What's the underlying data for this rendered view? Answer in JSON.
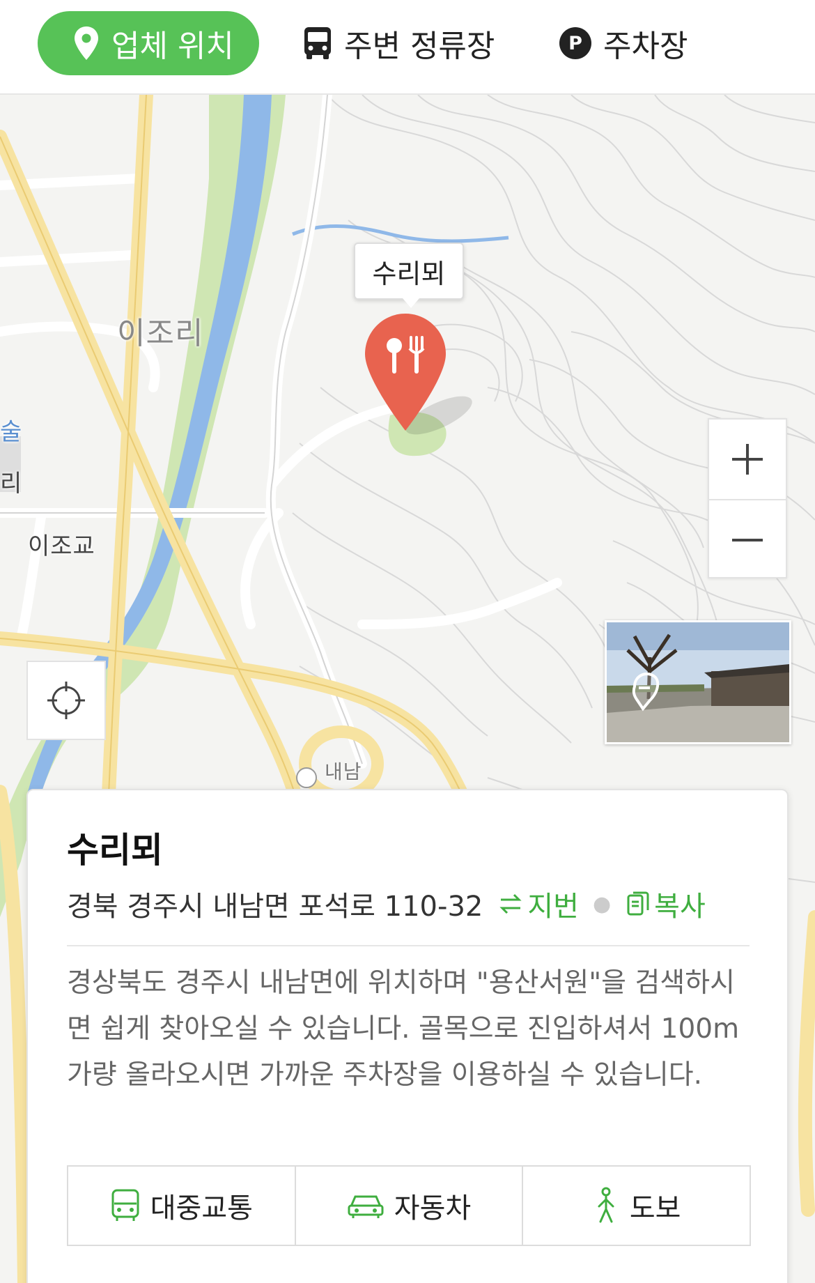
{
  "tabs": [
    {
      "label": "업체 위치",
      "icon": "location-pin-icon",
      "active": true
    },
    {
      "label": "주변 정류장",
      "icon": "bus-icon",
      "active": false
    },
    {
      "label": "주차장",
      "icon": "parking-icon",
      "active": false
    }
  ],
  "map": {
    "place_labels": [
      "이조리",
      "이조교",
      "술",
      "리",
      "내남"
    ],
    "marker_tooltip": "수리뫼",
    "marker_icon": "restaurant-pin-icon",
    "controls": {
      "zoom_in": "plus-icon",
      "zoom_out": "minus-icon",
      "current_location": "crosshair-icon",
      "roadview": "roadview-thumbnail"
    }
  },
  "business": {
    "name": "수리뫼",
    "address": "경북 경주시 내남면 포석로 110-32",
    "lot_number_label": "지번",
    "copy_label": "복사",
    "description": "경상북도 경주시 내남면에 위치하며 \"용산서원\"을 검색하시면 쉽게 찾아오실 수 있습니다. 골목으로 진입하셔서 100m 가량 올라오시면 가까운 주차장을 이용하실 수 있습니다.",
    "routes": [
      {
        "label": "대중교통",
        "icon": "public-transit-icon"
      },
      {
        "label": "자동차",
        "icon": "car-icon"
      },
      {
        "label": "도보",
        "icon": "walking-icon"
      }
    ]
  },
  "colors": {
    "accent_green": "#57c257",
    "action_green": "#3fae3f",
    "marker_red": "#e8634f",
    "road_yellow": "#f7e3a1",
    "water_blue": "#8fb8e8",
    "park_green": "#cfe6b3"
  }
}
